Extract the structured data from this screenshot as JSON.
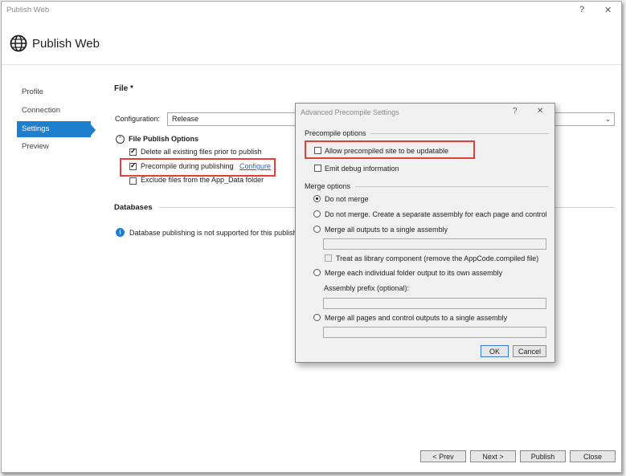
{
  "window": {
    "title": "Publish Web",
    "help": "?",
    "close": "✕",
    "header_title": "Publish Web"
  },
  "nav": {
    "items": [
      {
        "label": "Profile"
      },
      {
        "label": "Connection"
      },
      {
        "label": "Settings"
      },
      {
        "label": "Preview"
      }
    ],
    "selected": "Settings"
  },
  "settings": {
    "section_file": "File *",
    "configuration_label": "Configuration:",
    "configuration_value": "Release",
    "file_publish_options": "File Publish Options",
    "delete_files_label": "Delete all existing files prior to publish",
    "delete_files_checked": true,
    "precompile_label": "Precompile during publishing",
    "precompile_checked": true,
    "configure_link": "Configure",
    "exclude_label": "Exclude files from the App_Data folder",
    "exclude_checked": false,
    "section_databases": "Databases",
    "db_info": "Database publishing is not supported for this publish"
  },
  "footer": {
    "prev": "< Prev",
    "next": "Next >",
    "publish": "Publish",
    "close": "Close"
  },
  "dialog": {
    "title": "Advanced Precompile Settings",
    "help": "?",
    "close": "✕",
    "precompile_group": "Precompile options",
    "allow_updatable": "Allow precompiled site to be updatable",
    "allow_updatable_checked": false,
    "emit_debug": "Emit debug information",
    "emit_debug_checked": false,
    "merge_group": "Merge options",
    "opt_do_not_merge": "Do not merge",
    "opt_separate_assembly": "Do not merge. Create a separate assembly for each page and control",
    "opt_merge_single": "Merge all outputs to a single assembly",
    "treat_library": "Treat as library component (remove the AppCode.compiled file)",
    "opt_merge_folder": "Merge each individual folder output to its own assembly",
    "assembly_prefix": "Assembly prefix (optional):",
    "opt_merge_pages": "Merge all pages and control outputs to a single assembly",
    "selected_merge": "Do not merge",
    "ok": "OK",
    "cancel": "Cancel"
  }
}
